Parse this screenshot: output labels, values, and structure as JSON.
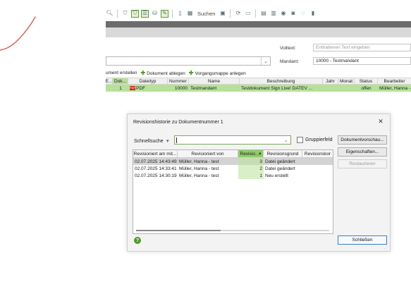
{
  "toolbar": {
    "search_label": "Suchen"
  },
  "form": {
    "volltext_label": "Volltext:",
    "volltext_placeholder": "Enthaltenen Text eingeben",
    "mandant_label": "Mandant:",
    "mandant_value": "10000 - Testmandant"
  },
  "actions": {
    "create_partial": "ument erstellen",
    "store": "Dokument ablegen",
    "folder": "Vorgangsmappe anlegen"
  },
  "doc_grid": {
    "headers": [
      "E...",
      "Dok...",
      "Dateityp",
      "Nummer",
      "Name",
      "Beschreibung",
      "Jahr",
      "Monat",
      "Status",
      "Bearbeiter"
    ],
    "row": {
      "e": "",
      "dok": "1",
      "pdf_icon_text": "PDF",
      "dateityp": "PDF",
      "nummer": "10000",
      "name": "Testmandant",
      "beschreibung": "Testdokument Sign Live! DATEV ...",
      "jahr": "",
      "monat": "",
      "status": "offen",
      "bearbeiter": "Müller, Hanna - te"
    }
  },
  "dialog": {
    "title": "Revisionshistorie zu Dokumentnummer 1",
    "close_glyph": "✕",
    "schnellsuche_label": "Schnellsuche",
    "gruppierfeld_label": "Gruppierfeld",
    "buttons": {
      "preview": "Dokumentvorschau...",
      "properties": "Eigenschaften...",
      "restore": "Restaurieren",
      "close": "Schließen"
    },
    "columns": [
      "Revisioniert am mit...",
      "Revisioniert von",
      "Revisio...",
      "Revisionsgrund",
      "Revisionskor"
    ],
    "rows": [
      {
        "date": "02.07.2025 14:43:49",
        "by": "Müller, Hanna - test",
        "rev": "3",
        "reason": "Datei geändert",
        "comment": ""
      },
      {
        "date": "02.07.2025 14:33:41",
        "by": "Müller, Hanna - test",
        "rev": "2",
        "reason": "Datei geändert",
        "comment": ""
      },
      {
        "date": "02.07.2025 14:30:19",
        "by": "Müller, Hanna - test",
        "rev": "1",
        "reason": "Neu erstellt",
        "comment": ""
      }
    ],
    "help_glyph": "?"
  },
  "colors": {
    "accent_green": "#b7e19a",
    "header_green": "#90cc6a",
    "pdf_red": "#d9261c",
    "dark_bar": "#6c6c6c"
  }
}
